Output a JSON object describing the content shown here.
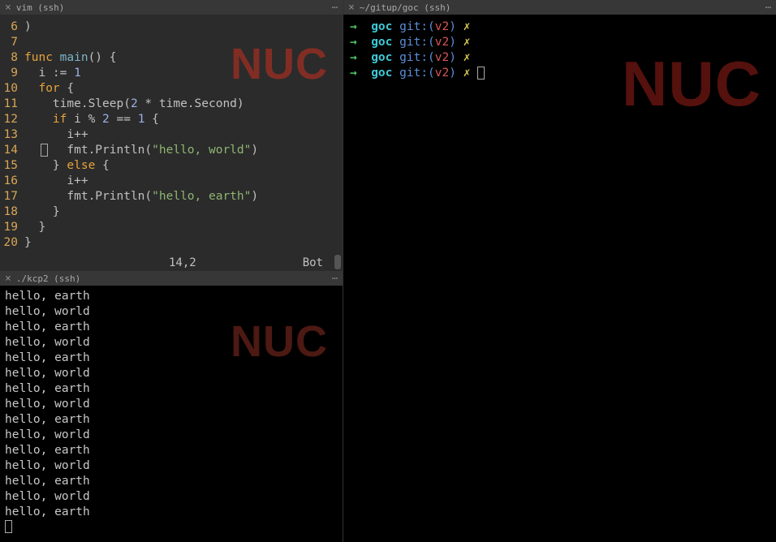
{
  "watermark": "NUC",
  "panes": {
    "vim": {
      "title": "vim (ssh)",
      "status": {
        "pos": "14,2",
        "loc": "Bot"
      },
      "lines": [
        {
          "n": 6,
          "tokens": [
            {
              "t": ")",
              "c": "code"
            }
          ]
        },
        {
          "n": 7,
          "tokens": []
        },
        {
          "n": 8,
          "tokens": [
            {
              "t": "func",
              "c": "kw"
            },
            {
              "t": " ",
              "c": "code"
            },
            {
              "t": "main",
              "c": "fn"
            },
            {
              "t": "() {",
              "c": "code"
            }
          ]
        },
        {
          "n": 9,
          "tokens": [
            {
              "t": "  i := ",
              "c": "code"
            },
            {
              "t": "1",
              "c": "num"
            }
          ]
        },
        {
          "n": 10,
          "tokens": [
            {
              "t": "  ",
              "c": "code"
            },
            {
              "t": "for",
              "c": "kw"
            },
            {
              "t": " {",
              "c": "code"
            }
          ]
        },
        {
          "n": 11,
          "tokens": [
            {
              "t": "    time.Sleep(",
              "c": "code"
            },
            {
              "t": "2",
              "c": "num"
            },
            {
              "t": " * time.Second)",
              "c": "code"
            }
          ]
        },
        {
          "n": 12,
          "tokens": [
            {
              "t": "    ",
              "c": "code"
            },
            {
              "t": "if",
              "c": "kw"
            },
            {
              "t": " i % ",
              "c": "code"
            },
            {
              "t": "2",
              "c": "num"
            },
            {
              "t": " == ",
              "c": "code"
            },
            {
              "t": "1",
              "c": "num"
            },
            {
              "t": " {",
              "c": "code"
            }
          ]
        },
        {
          "n": 13,
          "tokens": [
            {
              "t": "      i++",
              "c": "code"
            }
          ]
        },
        {
          "n": 14,
          "tokens": [
            {
              "t": "      fmt.Println(",
              "c": "code"
            },
            {
              "t": "\"hello, world\"",
              "c": "str"
            },
            {
              "t": ")",
              "c": "code"
            }
          ],
          "cursor": true
        },
        {
          "n": 15,
          "tokens": [
            {
              "t": "    } ",
              "c": "code"
            },
            {
              "t": "else",
              "c": "kw"
            },
            {
              "t": " {",
              "c": "code"
            }
          ]
        },
        {
          "n": 16,
          "tokens": [
            {
              "t": "      i++",
              "c": "code"
            }
          ]
        },
        {
          "n": 17,
          "tokens": [
            {
              "t": "      fmt.Println(",
              "c": "code"
            },
            {
              "t": "\"hello, earth\"",
              "c": "str"
            },
            {
              "t": ")",
              "c": "code"
            }
          ]
        },
        {
          "n": 18,
          "tokens": [
            {
              "t": "    }",
              "c": "code"
            }
          ]
        },
        {
          "n": 19,
          "tokens": [
            {
              "t": "  }",
              "c": "code"
            }
          ]
        },
        {
          "n": 20,
          "tokens": [
            {
              "t": "}",
              "c": "code"
            }
          ]
        }
      ]
    },
    "output": {
      "title": "./kcp2 (ssh)",
      "lines": [
        "hello, earth",
        "hello, world",
        "hello, earth",
        "hello, world",
        "hello, earth",
        "hello, world",
        "hello, earth",
        "hello, world",
        "hello, earth",
        "hello, world",
        "hello, earth",
        "hello, world",
        "hello, earth",
        "hello, world",
        "hello, earth"
      ]
    },
    "shell": {
      "title": "~/gitup/goc (ssh)",
      "prompts": [
        {
          "arrow": "→",
          "dir": "goc",
          "git": "git:(",
          "branch": "v2",
          "gitclose": ")",
          "x": "✗",
          "cursor": false
        },
        {
          "arrow": "→",
          "dir": "goc",
          "git": "git:(",
          "branch": "v2",
          "gitclose": ")",
          "x": "✗",
          "cursor": false
        },
        {
          "arrow": "→",
          "dir": "goc",
          "git": "git:(",
          "branch": "v2",
          "gitclose": ")",
          "x": "✗",
          "cursor": false
        },
        {
          "arrow": "→",
          "dir": "goc",
          "git": "git:(",
          "branch": "v2",
          "gitclose": ")",
          "x": "✗",
          "cursor": true
        }
      ]
    }
  }
}
